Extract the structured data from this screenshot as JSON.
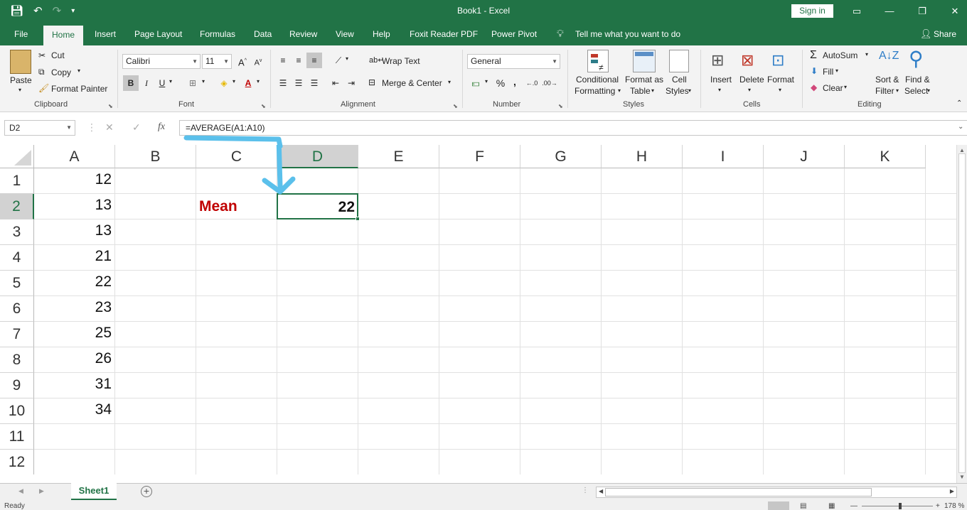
{
  "window": {
    "title": "Book1  -  Excel",
    "sign_in": "Sign in"
  },
  "menu": {
    "tabs": [
      "File",
      "Home",
      "Insert",
      "Page Layout",
      "Formulas",
      "Data",
      "Review",
      "View",
      "Help",
      "Foxit Reader PDF",
      "Power Pivot"
    ],
    "tell_me": "Tell me what you want to do",
    "share": "Share"
  },
  "ribbon": {
    "clipboard": {
      "label": "Clipboard",
      "paste": "Paste",
      "cut": "Cut",
      "copy": "Copy",
      "format_painter": "Format Painter"
    },
    "font": {
      "label": "Font",
      "name": "Calibri",
      "size": "11",
      "bold": "B",
      "italic": "I",
      "underline": "U"
    },
    "alignment": {
      "label": "Alignment",
      "wrap_text": "Wrap Text",
      "merge_center": "Merge & Center"
    },
    "number": {
      "label": "Number",
      "format": "General",
      "percent": "%",
      "comma": ","
    },
    "styles": {
      "label": "Styles",
      "conditional_1": "Conditional",
      "conditional_2": "Formatting",
      "format_table_1": "Format as",
      "format_table_2": "Table",
      "cell_styles_1": "Cell",
      "cell_styles_2": "Styles"
    },
    "cells": {
      "label": "Cells",
      "insert": "Insert",
      "delete": "Delete",
      "format": "Format"
    },
    "editing": {
      "label": "Editing",
      "autosum": "AutoSum",
      "fill": "Fill",
      "clear": "Clear",
      "sort_1": "Sort &",
      "sort_2": "Filter",
      "find_1": "Find &",
      "find_2": "Select"
    }
  },
  "formula_bar": {
    "name_box": "D2",
    "fx": "fx",
    "formula": "=AVERAGE(A1:A10)"
  },
  "sheet": {
    "columns": [
      "A",
      "B",
      "C",
      "D",
      "E",
      "F",
      "G",
      "H",
      "I",
      "J",
      "K"
    ],
    "rows": [
      "1",
      "2",
      "3",
      "4",
      "5",
      "6",
      "7",
      "8",
      "9",
      "10",
      "11",
      "12"
    ],
    "selected_cell": "D2",
    "column_a_values": [
      "12",
      "13",
      "13",
      "21",
      "22",
      "23",
      "25",
      "26",
      "31",
      "34"
    ],
    "c2_label": "Mean",
    "d2_value": "22",
    "label_color": "#c00000",
    "annotation_arrow_color": "#5bc0eb"
  },
  "sheet_tabs": [
    "Sheet1"
  ],
  "status": {
    "ready": "Ready",
    "zoom": "178 %"
  },
  "colors": {
    "accent": "#217346"
  }
}
